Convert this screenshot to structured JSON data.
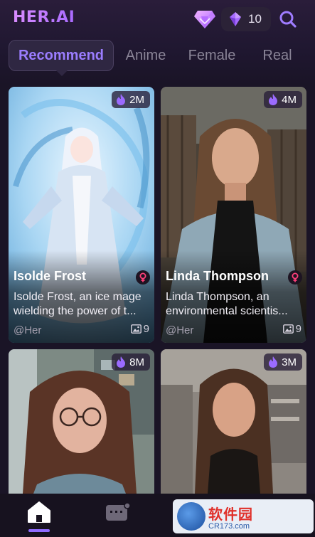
{
  "app": {
    "logo_text": "HER.AI",
    "coin_count": "10"
  },
  "tabs": [
    {
      "label": "Recommend",
      "active": true
    },
    {
      "label": "Anime",
      "active": false
    },
    {
      "label": "Female",
      "active": false
    },
    {
      "label": "Real",
      "active": false
    }
  ],
  "cards": [
    {
      "name": "Isolde Frost",
      "description": "Isolde Frost, an ice mage wielding the power of t...",
      "popularity": "2M",
      "author": "@Her",
      "image_count": "9",
      "gender_icon": "female-icon",
      "image_subject": "anime ice mage"
    },
    {
      "name": "Linda Thompson",
      "description": "Linda Thompson, an environmental scientis...",
      "popularity": "4M",
      "author": "@Her",
      "image_count": "9",
      "gender_icon": "female-icon",
      "image_subject": "realistic portrait outdoors"
    },
    {
      "popularity": "8M",
      "image_subject": "realistic portrait with glasses"
    },
    {
      "popularity": "3M",
      "image_subject": "realistic portrait in kitchen"
    }
  ],
  "nav": {
    "items": [
      {
        "icon": "home-icon",
        "active": true
      },
      {
        "icon": "chat-icon",
        "active": false
      }
    ]
  },
  "watermark": {
    "title": "软件园",
    "subtitle": "CR173.com"
  },
  "colors": {
    "accent": "#9b7dff",
    "background": "#1a1426",
    "tab_inactive": "#8a8497"
  }
}
